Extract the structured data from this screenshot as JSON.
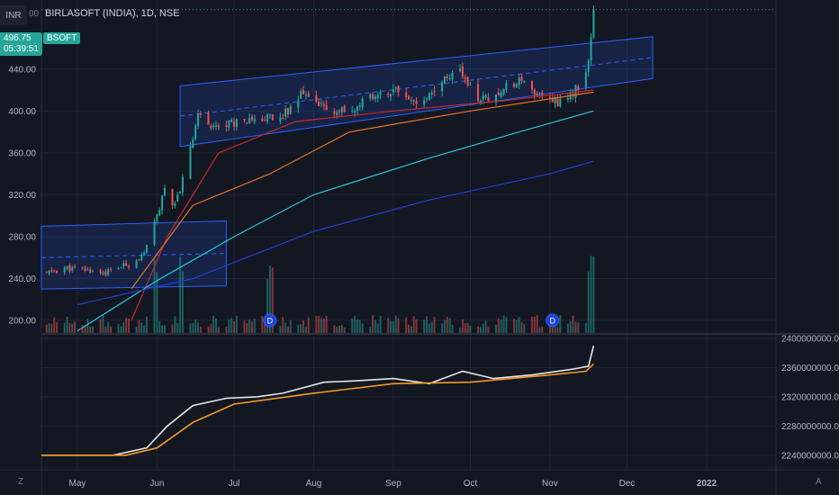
{
  "header": {
    "currency": "INR",
    "currency_hint": "00",
    "title": "BIRLASOFT (INDIA), 1D, NSE"
  },
  "price_badge": {
    "price": "496.75",
    "countdown": "05:39:51"
  },
  "symbol_badge": "BSOFT",
  "corner_left": "Z",
  "corner_right": "A",
  "colors": {
    "background": "#131722",
    "up": "#26a69a",
    "down": "#ef5350",
    "channel": "#2962ff",
    "ma_fast": "#c62828",
    "ma_mid": "#e8702a",
    "ma_slow": "#26c6da",
    "ma_long": "#1e40d8",
    "obv": "#e6e6e6",
    "obv_signal": "#f59a23"
  },
  "chart_data": [
    {
      "type": "candlestick",
      "title": "BIRLASOFT (INDIA), 1D, NSE",
      "x_ticks": [
        {
          "label": "May",
          "date": "2021-05-01"
        },
        {
          "label": "Jun",
          "date": "2021-06-01"
        },
        {
          "label": "Jul",
          "date": "2021-07-01"
        },
        {
          "label": "Aug",
          "date": "2021-08-01"
        },
        {
          "label": "Sep",
          "date": "2021-09-01"
        },
        {
          "label": "Oct",
          "date": "2021-10-01"
        },
        {
          "label": "Nov",
          "date": "2021-11-01"
        },
        {
          "label": "Dec",
          "date": "2021-12-01"
        },
        {
          "label": "2022",
          "date": "2022-01-01"
        }
      ],
      "x_range": [
        "2021-04-17",
        "2022-01-28"
      ],
      "y_ticks": [
        "200.00",
        "240.00",
        "280.00",
        "320.00",
        "360.00",
        "400.00",
        "440.00"
      ],
      "y_range": [
        188,
        506
      ],
      "last_price": 496.75,
      "anchors": [
        [
          "2021-04-19",
          245
        ],
        [
          "2021-04-26",
          250
        ],
        [
          "2021-05-04",
          248
        ],
        [
          "2021-05-12",
          246
        ],
        [
          "2021-05-20",
          253
        ],
        [
          "2021-05-27",
          262
        ],
        [
          "2021-06-01",
          300
        ],
        [
          "2021-06-04",
          325
        ],
        [
          "2021-06-08",
          310
        ],
        [
          "2021-06-11",
          335
        ],
        [
          "2021-06-14",
          368
        ],
        [
          "2021-06-17",
          395
        ],
        [
          "2021-06-24",
          385
        ],
        [
          "2021-07-01",
          390
        ],
        [
          "2021-07-08",
          395
        ],
        [
          "2021-07-15",
          392
        ],
        [
          "2021-07-21",
          398
        ],
        [
          "2021-07-27",
          415
        ],
        [
          "2021-08-03",
          405
        ],
        [
          "2021-08-11",
          398
        ],
        [
          "2021-08-18",
          405
        ],
        [
          "2021-08-25",
          418
        ],
        [
          "2021-09-01",
          420
        ],
        [
          "2021-09-08",
          410
        ],
        [
          "2021-09-15",
          415
        ],
        [
          "2021-09-21",
          432
        ],
        [
          "2021-09-27",
          438
        ],
        [
          "2021-10-04",
          408
        ],
        [
          "2021-10-12",
          418
        ],
        [
          "2021-10-19",
          428
        ],
        [
          "2021-10-25",
          420
        ],
        [
          "2021-11-01",
          410
        ],
        [
          "2021-11-05",
          408
        ],
        [
          "2021-11-12",
          422
        ],
        [
          "2021-11-16",
          445
        ],
        [
          "2021-11-17",
          472
        ],
        [
          "2021-11-18",
          496.75
        ]
      ],
      "moving_averages": [
        {
          "color_key": "ma_fast",
          "points": [
            [
              "2021-05-22",
              200
            ],
            [
              "2021-06-05",
              280
            ],
            [
              "2021-06-25",
              360
            ],
            [
              "2021-07-25",
              390
            ],
            [
              "2021-09-01",
              400
            ],
            [
              "2021-10-15",
              410
            ],
            [
              "2021-11-18",
              420
            ]
          ]
        },
        {
          "color_key": "ma_mid",
          "points": [
            [
              "2021-05-22",
              230
            ],
            [
              "2021-06-15",
              310
            ],
            [
              "2021-07-15",
              340
            ],
            [
              "2021-08-15",
              380
            ],
            [
              "2021-10-01",
              400
            ],
            [
              "2021-11-18",
              418
            ]
          ]
        },
        {
          "color_key": "ma_slow",
          "points": [
            [
              "2021-05-01",
              190
            ],
            [
              "2021-06-01",
              238
            ],
            [
              "2021-07-01",
              280
            ],
            [
              "2021-08-01",
              320
            ],
            [
              "2021-09-15",
              355
            ],
            [
              "2021-10-20",
              380
            ],
            [
              "2021-11-18",
              400
            ]
          ]
        },
        {
          "color_key": "ma_long",
          "points": [
            [
              "2021-05-01",
              215
            ],
            [
              "2021-06-15",
              240
            ],
            [
              "2021-08-01",
              285
            ],
            [
              "2021-09-15",
              315
            ],
            [
              "2021-11-01",
              340
            ],
            [
              "2021-11-18",
              352
            ]
          ]
        }
      ],
      "channels": [
        {
          "start": "2021-04-17",
          "end": "2021-06-28",
          "top": [
            290,
            295
          ],
          "bottom": [
            230,
            233
          ]
        },
        {
          "start": "2021-06-10",
          "end": "2021-12-11",
          "top": [
            424,
            471
          ],
          "bottom": [
            366,
            431
          ]
        }
      ],
      "events": [
        "2021-07-15",
        "2021-11-02"
      ],
      "volume_spikes": [
        "2021-05-31",
        "2021-06-11",
        "2021-07-15",
        "2021-11-17"
      ]
    },
    {
      "type": "line",
      "y_ticks": [
        "2240000000.00",
        "2280000000.00",
        "2320000000.00",
        "2360000000.00",
        "2400000000.00"
      ],
      "y_range": [
        2220000000,
        2405000000
      ],
      "series": [
        {
          "color_key": "obv",
          "points": [
            [
              "2021-04-17",
              2240000000
            ],
            [
              "2021-05-15",
              2240000000
            ],
            [
              "2021-05-28",
              2250000000
            ],
            [
              "2021-06-05",
              2280000000
            ],
            [
              "2021-06-15",
              2308000000
            ],
            [
              "2021-06-28",
              2318000000
            ],
            [
              "2021-07-10",
              2320000000
            ],
            [
              "2021-07-20",
              2325000000
            ],
            [
              "2021-08-05",
              2340000000
            ],
            [
              "2021-08-18",
              2342000000
            ],
            [
              "2021-09-01",
              2345000000
            ],
            [
              "2021-09-15",
              2338000000
            ],
            [
              "2021-09-28",
              2355000000
            ],
            [
              "2021-10-10",
              2345000000
            ],
            [
              "2021-10-25",
              2350000000
            ],
            [
              "2021-11-10",
              2358000000
            ],
            [
              "2021-11-16",
              2362000000
            ],
            [
              "2021-11-18",
              2390000000
            ]
          ]
        },
        {
          "color_key": "obv_signal",
          "points": [
            [
              "2021-04-17",
              2240000000
            ],
            [
              "2021-05-20",
              2240000000
            ],
            [
              "2021-06-01",
              2250000000
            ],
            [
              "2021-06-15",
              2285000000
            ],
            [
              "2021-07-01",
              2310000000
            ],
            [
              "2021-08-01",
              2325000000
            ],
            [
              "2021-09-01",
              2338000000
            ],
            [
              "2021-10-01",
              2340000000
            ],
            [
              "2021-11-01",
              2350000000
            ],
            [
              "2021-11-15",
              2355000000
            ],
            [
              "2021-11-18",
              2365000000
            ]
          ]
        }
      ]
    }
  ]
}
